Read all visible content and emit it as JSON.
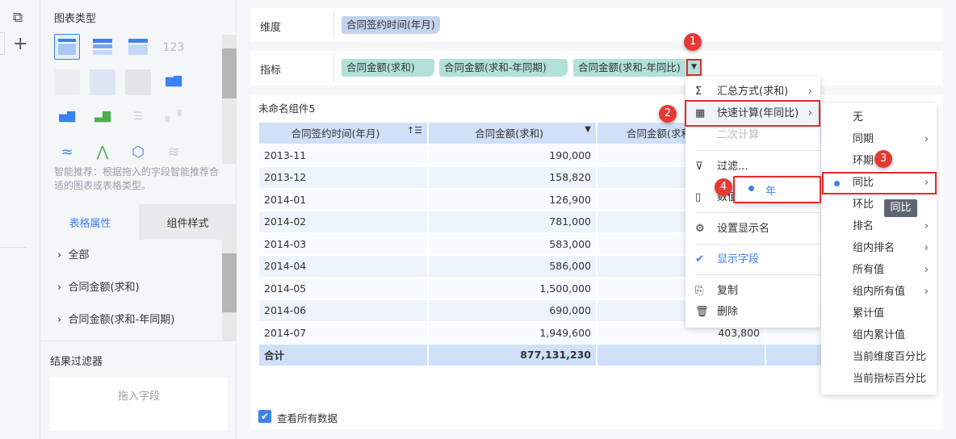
{
  "sidebar": {
    "chart_type_title": "图表类型",
    "recommend_text": "智能推荐：根据拖入的字段智能推荐合适的图表或表格类型。",
    "tabs": [
      "表格属性",
      "组件样式"
    ],
    "props": [
      "全部",
      "合同金额(求和)",
      "合同金额(求和-年同期)"
    ],
    "result_filter_title": "结果过滤器",
    "drop_placeholder": "拖入字段"
  },
  "fields": {
    "dimension_label": "维度",
    "dimension_pills": [
      "合同签约时间(年月)"
    ],
    "metric_label": "指标",
    "metric_pills": [
      "合同金额(求和)",
      "合同金额(求和-年同期)",
      "合同金额(求和-年同比)"
    ]
  },
  "component": {
    "title": "未命名组件5",
    "headers": [
      "合同签约时间(年月)",
      "合同金额(求和)",
      "合同金额(求和"
    ],
    "rows": [
      [
        "2013-11",
        "190,000",
        ""
      ],
      [
        "2013-12",
        "158,820",
        ""
      ],
      [
        "2014-01",
        "126,900",
        ""
      ],
      [
        "2014-02",
        "781,000",
        ""
      ],
      [
        "2014-03",
        "583,000",
        ""
      ],
      [
        "2014-04",
        "586,000",
        ""
      ],
      [
        "2014-05",
        "1,500,000",
        ""
      ],
      [
        "2014-06",
        "690,000",
        ""
      ],
      [
        "2014-07",
        "1,949,600",
        "403,800"
      ]
    ],
    "total": [
      "合计",
      "877,131,230",
      ""
    ],
    "show_all_label": "查看所有数据"
  },
  "menu": {
    "items": [
      "汇总方式(求和)",
      "快速计算(年同比)",
      "二次计算",
      "过滤...",
      "数值",
      "设置显示名",
      "显示字段",
      "复制",
      "删除"
    ]
  },
  "submenu": {
    "items": [
      "无",
      "同期",
      "环期",
      "同比",
      "环比",
      "排名",
      "组内排名",
      "所有值",
      "组内所有值",
      "累计值",
      "组内累计值",
      "当前维度百分比",
      "当前指标百分比"
    ],
    "tooltip": "同比"
  },
  "year_menu": {
    "item": "年"
  },
  "badges": [
    "1",
    "2",
    "3",
    "4"
  ],
  "colors": {
    "accent": "#3a82f0",
    "dimension_pill": "#c3d3ef",
    "metric_pill": "#b1e1d9",
    "highlight": "#e32a2a"
  }
}
